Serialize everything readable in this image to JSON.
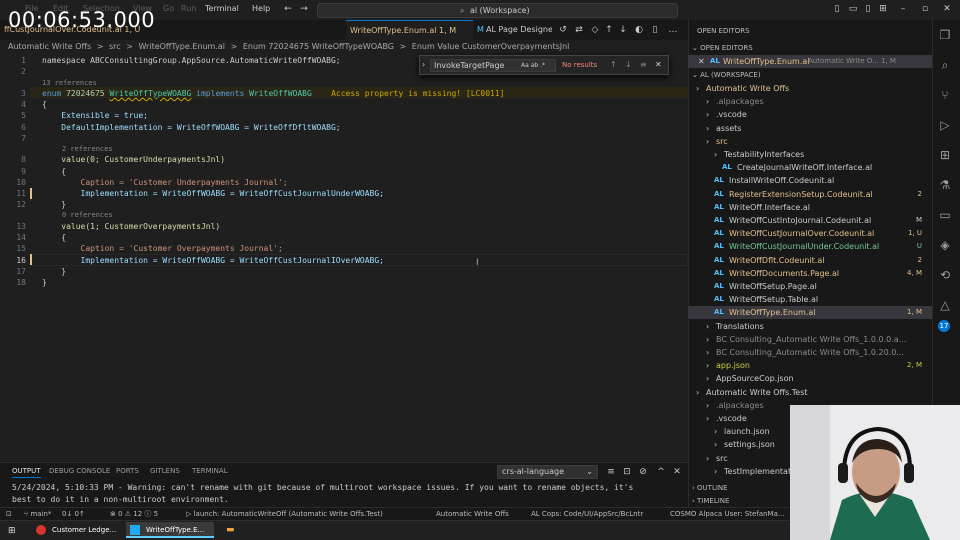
{
  "timer": "00:06:53.000",
  "menu": [
    "File",
    "Edit",
    "Selection",
    "View",
    "Go",
    "Run",
    "Terminal",
    "Help"
  ],
  "search": {
    "value": "al (Workspace)"
  },
  "tabs": [
    {
      "label": "ffCustJournalOver.Codeunit.al 1, U",
      "state": "mod"
    },
    {
      "label": "WriteOffType.Enum.al 1, M",
      "state": "active"
    },
    {
      "label": "AL Page Designer",
      "state": "plain"
    }
  ],
  "breadcrumb": [
    "Automatic Write Offs",
    ">",
    "src",
    ">",
    "WriteOffType.Enum.al",
    ">",
    "Enum 72024675 WriteOffTypeWOABG",
    ">",
    "Enum Value CustomerOverpaymentsJnl"
  ],
  "find": {
    "value": "InvokeTargetPage",
    "result": "No results",
    "opts": "Aa ab .*"
  },
  "editor": {
    "lines": [
      {
        "n": "1",
        "text": "namespace ABCConsultingGroup.AppSource.AutomaticWriteOffWOABG;"
      },
      {
        "n": "2",
        "text": ""
      },
      {
        "n": "3",
        "p1": "enum",
        "p2": "72024675",
        "p3": "WriteOffTypeWOABG",
        "p4": "implements",
        "p5": "WriteOffWOABG",
        "warn": "Access property is missing! [LC0011]"
      },
      {
        "n": "4",
        "text": "{"
      },
      {
        "n": "5",
        "text": "    Extensible = true;"
      },
      {
        "n": "6",
        "text": "    DefaultImplementation = WriteOffWOABG = WriteOffDfltWOABG;"
      },
      {
        "n": "7",
        "text": ""
      },
      {
        "n": "8",
        "text": "    value(0; CustomerUnderpaymentsJnl)"
      },
      {
        "n": "9",
        "text": "    {"
      },
      {
        "n": "10",
        "text": "        Caption = 'Customer Underpayments Journal';"
      },
      {
        "n": "11",
        "text": "        Implementation = WriteOffWOABG = WriteOffCustJournalUnderWOABG;"
      },
      {
        "n": "12",
        "text": "    }"
      },
      {
        "n": "13",
        "text": "    value(1; CustomerOverpaymentsJnl)"
      },
      {
        "n": "14",
        "text": "    {"
      },
      {
        "n": "15",
        "text": "        Caption = 'Customer Overpayments Journal';"
      },
      {
        "n": "16",
        "text": "        Implementation = WriteOffWOABG = WriteOffCustJournalIOverWOABG;"
      },
      {
        "n": "17",
        "text": "    }"
      },
      {
        "n": "18",
        "text": "}"
      }
    ],
    "lens": {
      "l3": "13 references",
      "l8": "2 references",
      "l13": "0 references"
    }
  },
  "panel": {
    "tabs": [
      "OUTPUT",
      "DEBUG CONSOLE",
      "PORTS",
      "GITLENS",
      "TERMINAL"
    ],
    "channel": "crs-al-language",
    "line1": "5/24/2024, 5:10:33 PM - Warning: can't rename with git because of multiroot workspace issues.  If you want to rename objects, it's",
    "line2": "best to do it in a non-multiroot environment."
  },
  "sidebar": {
    "open_editors_title": "OPEN EDITORS",
    "open_editors_section": "OPEN EDITORS",
    "open_file": "WriteOffType.Enum.al",
    "open_file_path": "Automatic Write O... 1, M",
    "workspace_title": "AL (WORKSPACE)",
    "tree": [
      {
        "label": "Automatic Write Offs",
        "indent": 10,
        "cls": "c-mod",
        "bdg": ""
      },
      {
        "label": ".alpackages",
        "indent": 20,
        "cls": "c-dim",
        "bdg": ""
      },
      {
        "label": ".vscode",
        "indent": 20,
        "cls": "c-def",
        "bdg": ""
      },
      {
        "label": "assets",
        "indent": 20,
        "cls": "c-def",
        "bdg": ""
      },
      {
        "label": "src",
        "indent": 20,
        "cls": "c-mod",
        "bdg": ""
      },
      {
        "label": "TestabilityInterfaces",
        "indent": 28,
        "cls": "c-def",
        "bdg": ""
      },
      {
        "label": "CreateJournalWriteOff.Interface.al",
        "indent": 36,
        "cls": "c-def",
        "bdg": "",
        "al": true
      },
      {
        "label": "InstallWriteOff.Codeunit.al",
        "indent": 28,
        "cls": "c-def",
        "bdg": "",
        "al": true
      },
      {
        "label": "RegisterExtensionSetup.Codeunit.al",
        "indent": 28,
        "cls": "c-mod",
        "bdg": "2",
        "al": true
      },
      {
        "label": "WriteOff.Interface.al",
        "indent": 28,
        "cls": "c-def",
        "bdg": "",
        "al": true
      },
      {
        "label": "WriteOffCustIntoJournal.Codeunit.al",
        "indent": 28,
        "cls": "c-def",
        "bdg": "M",
        "al": true
      },
      {
        "label": "WriteOffCustJournalOver.Codeunit.al",
        "indent": 28,
        "cls": "c-mod",
        "bdg": "1, U",
        "al": true
      },
      {
        "label": "WriteOffCustJournalUnder.Codeunit.al",
        "indent": 28,
        "cls": "c-new",
        "bdg": "U",
        "al": true
      },
      {
        "label": "WriteOffDflt.Codeunit.al",
        "indent": 28,
        "cls": "c-mod",
        "bdg": "2",
        "al": true
      },
      {
        "label": "WriteOffDocuments.Page.al",
        "indent": 28,
        "cls": "c-mod",
        "bdg": "4, M",
        "al": true
      },
      {
        "label": "WriteOffSetup.Page.al",
        "indent": 28,
        "cls": "c-def",
        "bdg": "",
        "al": true
      },
      {
        "label": "WriteOffSetup.Table.al",
        "indent": 28,
        "cls": "c-def",
        "bdg": "",
        "al": true
      },
      {
        "label": "WriteOffType.Enum.al",
        "indent": 28,
        "cls": "c-mod",
        "bdg": "1, M",
        "al": true,
        "sel": true
      },
      {
        "label": "Translations",
        "indent": 20,
        "cls": "c-def",
        "bdg": ""
      },
      {
        "label": "BC Consulting_Automatic Write Offs_1.0.0.0.a...",
        "indent": 20,
        "cls": "c-dim",
        "bdg": ""
      },
      {
        "label": "BC Consulting_Automatic Write Offs_1.0.20.0...",
        "indent": 20,
        "cls": "c-dim",
        "bdg": ""
      },
      {
        "label": "app.json",
        "indent": 20,
        "cls": "c-json",
        "bdg": "2, M"
      },
      {
        "label": "AppSourceCop.json",
        "indent": 20,
        "cls": "c-def",
        "bdg": ""
      },
      {
        "label": "Automatic Write Offs.Test",
        "indent": 10,
        "cls": "c-def",
        "bdg": ""
      },
      {
        "label": ".alpackages",
        "indent": 20,
        "cls": "c-dim",
        "bdg": ""
      },
      {
        "label": ".vscode",
        "indent": 20,
        "cls": "c-def",
        "bdg": ""
      },
      {
        "label": "launch.json",
        "indent": 28,
        "cls": "c-def",
        "bdg": ""
      },
      {
        "label": "settings.json",
        "indent": 28,
        "cls": "c-def",
        "bdg": ""
      },
      {
        "label": "src",
        "indent": 20,
        "cls": "c-def",
        "bdg": ""
      },
      {
        "label": "TestImplementati...",
        "indent": 28,
        "cls": "c-def",
        "bdg": ""
      }
    ],
    "outline": "OUTLINE",
    "timeline": "TIMELINE"
  },
  "status": {
    "branch": "main*",
    "sync": "0↓ 0↑",
    "problems": "⊗ 0 ⚠ 12 ⓘ 5",
    "launch": "launch: AutomaticWriteOff (Automatic Write Offs.Test)",
    "project": "Automatic Write Offs",
    "cops": "AL Cops: Code/UI/AppSrc/BcLntr",
    "user": "COSMO Alpaca User: StefanMa..."
  },
  "taskbar": {
    "app1": "Customer Ledge...",
    "app2": "WriteOffType.E..."
  },
  "colors": {
    "accent": "#0078d4",
    "warning": "#cca700",
    "modified": "#e2c08d",
    "untracked": "#73c991"
  }
}
